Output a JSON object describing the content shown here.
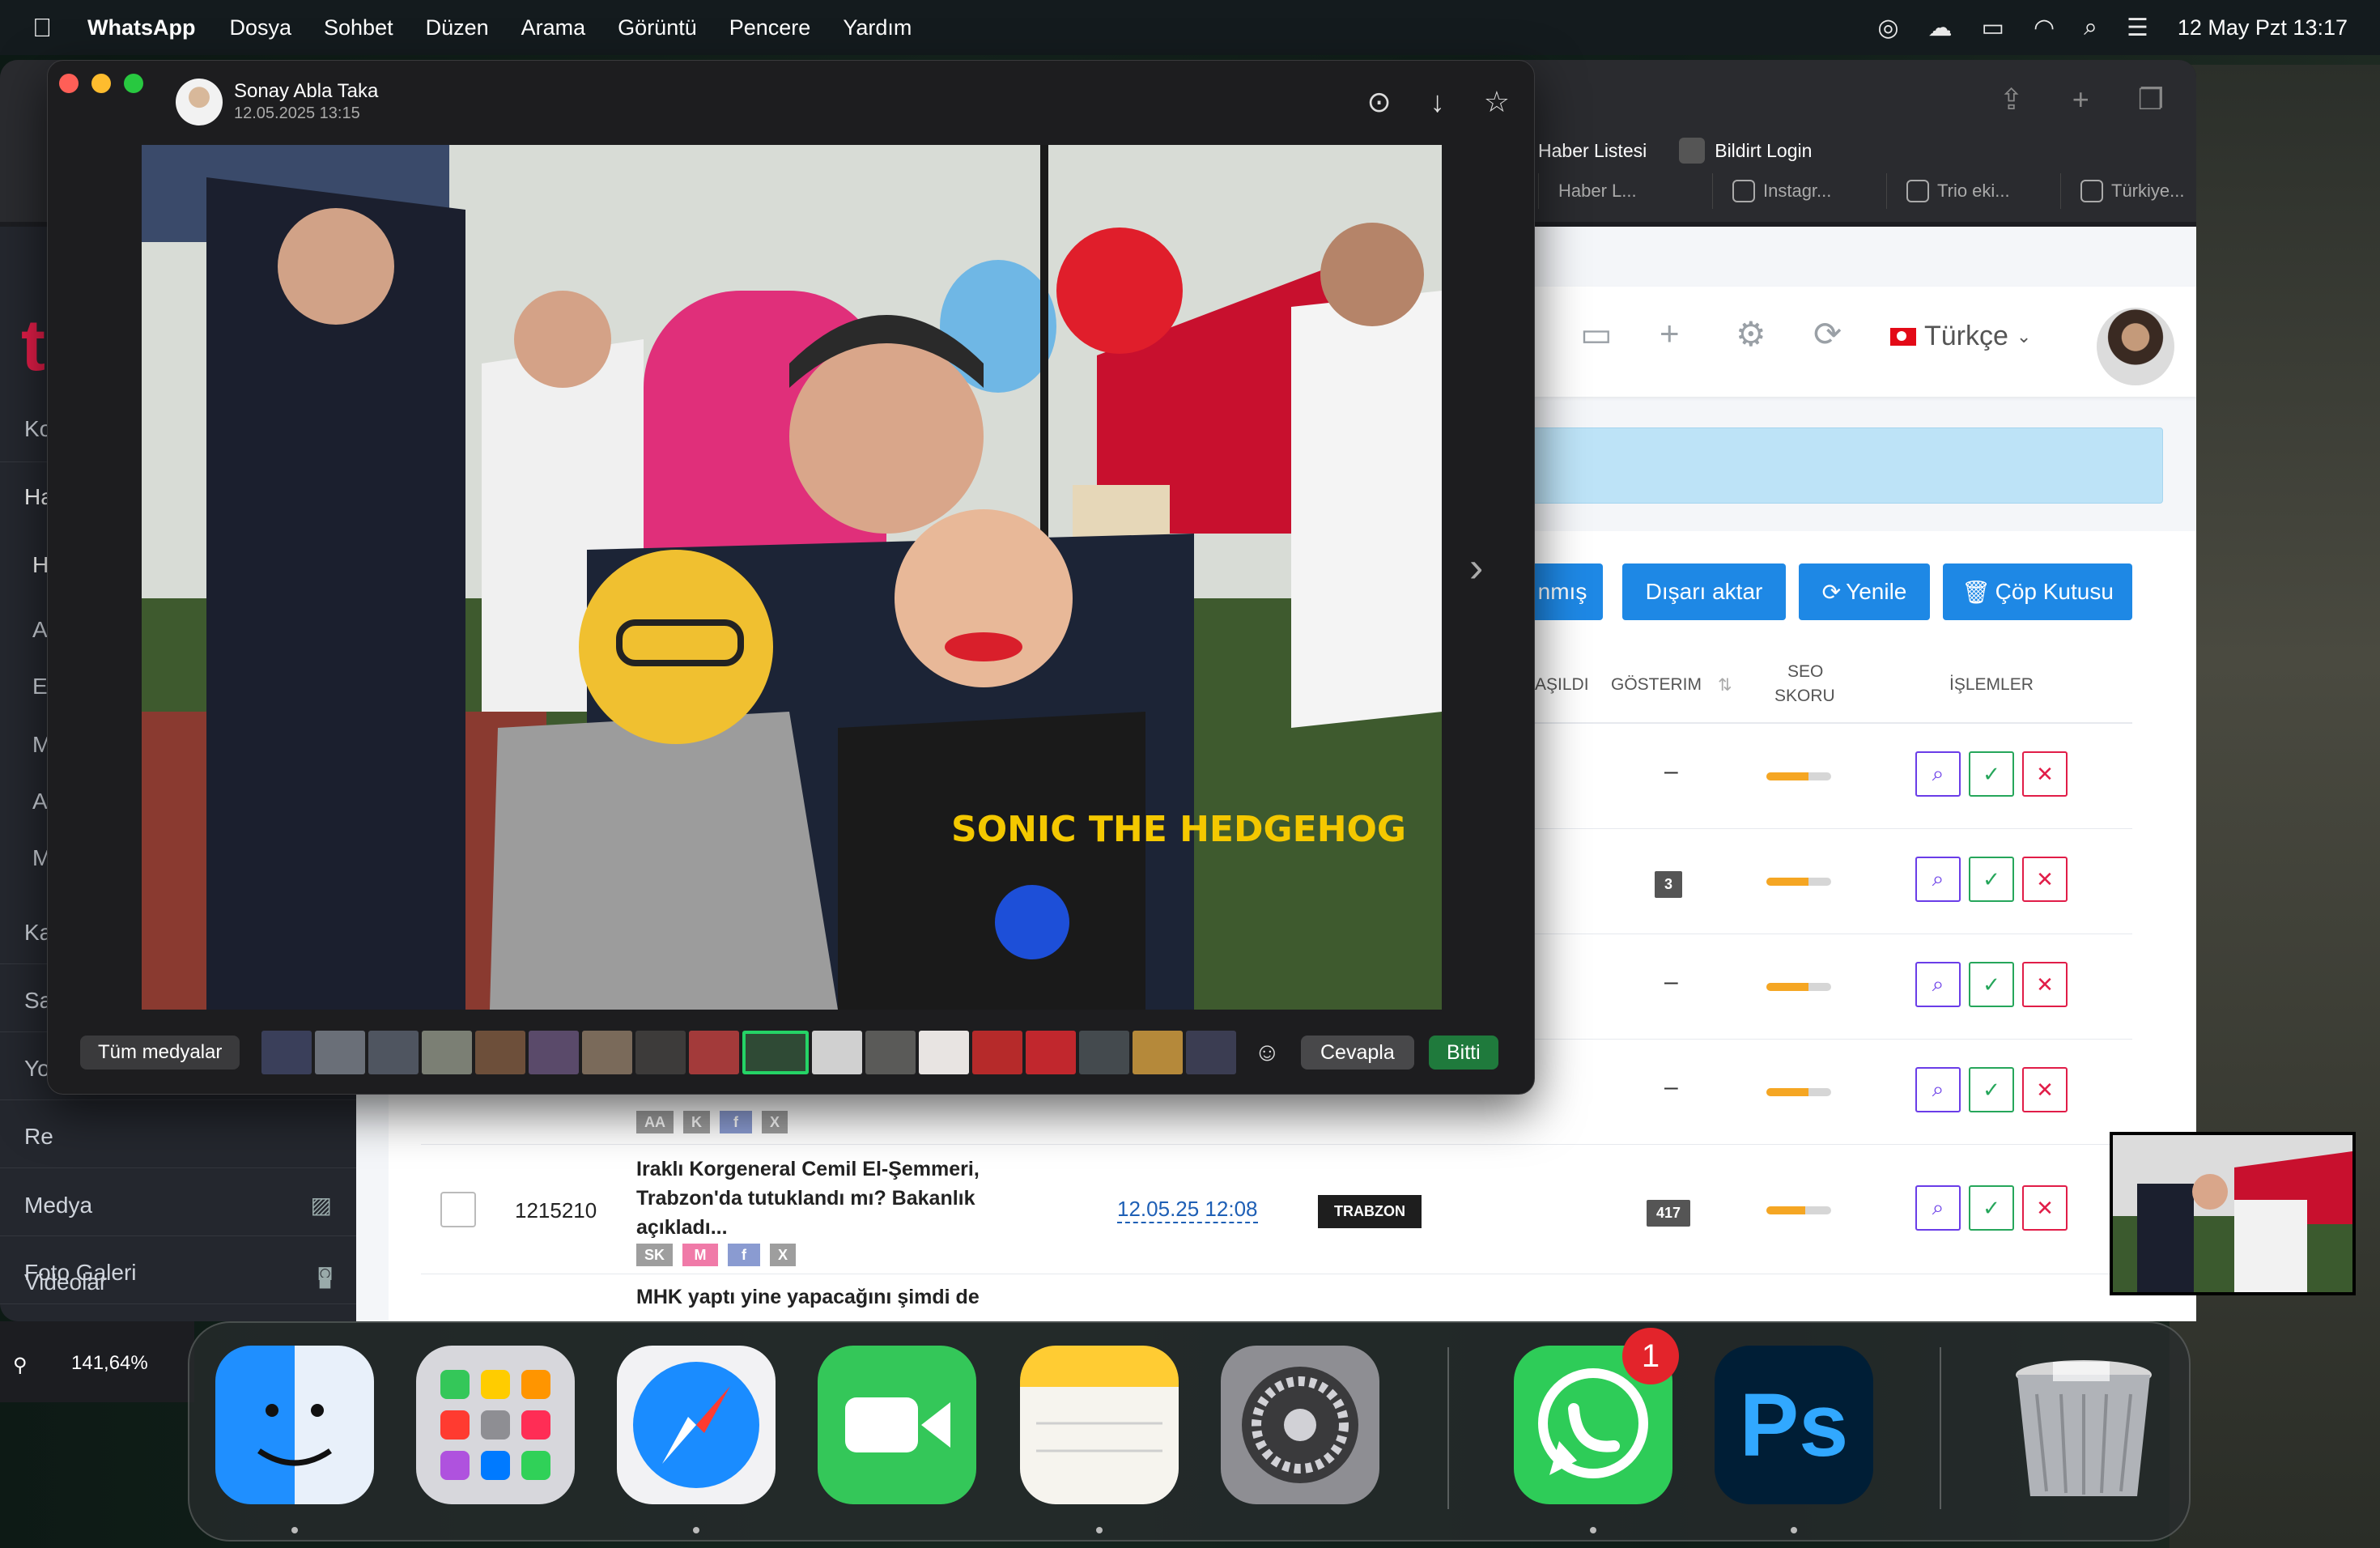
{
  "menubar": {
    "app_name": "WhatsApp",
    "menus": [
      "Dosya",
      "Sohbet",
      "Düzen",
      "Arama",
      "Görüntü",
      "Pencere",
      "Yardım"
    ],
    "clock": "12 May Pzt 13:17"
  },
  "browser": {
    "bookmarks": [
      "Haber Listesi",
      "Bildirt Login"
    ],
    "tabs": [
      "Haber L...",
      "Instagr...",
      "Trio eki...",
      "Türkiye..."
    ],
    "language": "Türkçe",
    "sidebar": {
      "partial_items": [
        "Ko",
        "Ha",
        "H",
        "A",
        "E",
        "M",
        "A",
        "M",
        "Ka",
        "Sa",
        "Yo",
        "Re"
      ],
      "items": [
        {
          "label": "Medya",
          "icon": "image-icon"
        },
        {
          "label": "Foto Galeri",
          "icon": "camera-icon"
        },
        {
          "label": "Videolar",
          "icon": "video-icon"
        }
      ]
    },
    "zoom": "141,64%",
    "actions": {
      "published_partial": "nmış",
      "export": "Dışarı aktar",
      "refresh": "Yenile",
      "trash": "Çöp Kutusu"
    },
    "columns": {
      "published_partial": "AŞILDI",
      "views": "GÖSTERIM",
      "seo_line1": "SEO",
      "seo_line2": "SKORU",
      "operations": "İŞLEMLER"
    },
    "rows": [
      {
        "views": "–",
        "seo": 0.65
      },
      {
        "views": "3",
        "seo": 0.65
      },
      {
        "views": "–",
        "seo": 0.65
      },
      {
        "views": "–",
        "seo": 0.65,
        "tags": [
          "AA",
          "K",
          "f",
          "X"
        ]
      },
      {
        "id": "1215210",
        "title": "Iraklı Korgeneral Cemil El-Şemmeri, Trabzon'da tutuklandı mı? Bakanlık açıkladı...",
        "date": "12.05.25 12:08",
        "category": "TRABZON",
        "views": "417",
        "seo": 0.6,
        "tags": [
          "SK",
          "M",
          "f",
          "X"
        ]
      }
    ],
    "next_row_title": "MHK yaptı yine yapacağını şimdi de"
  },
  "viewer": {
    "sender": "Sonay Abla Taka",
    "date": "12.05.2025 13:15",
    "all_media": "Tüm medyalar",
    "reply": "Cevapla",
    "done": "Bitti",
    "photo_shirt_text": "SONIC THE HEDGEHOG"
  },
  "dock": {
    "apps": [
      "Finder",
      "Launchpad",
      "Safari",
      "FaceTime",
      "Notes",
      "System Settings",
      "WhatsApp",
      "Photoshop",
      "Trash"
    ],
    "whatsapp_badge": "1",
    "photoshop_label": "Ps"
  },
  "colors": {
    "accent_blue": "#1e88e5",
    "whatsapp_green": "#25d366",
    "brand_red": "#e11d48"
  }
}
